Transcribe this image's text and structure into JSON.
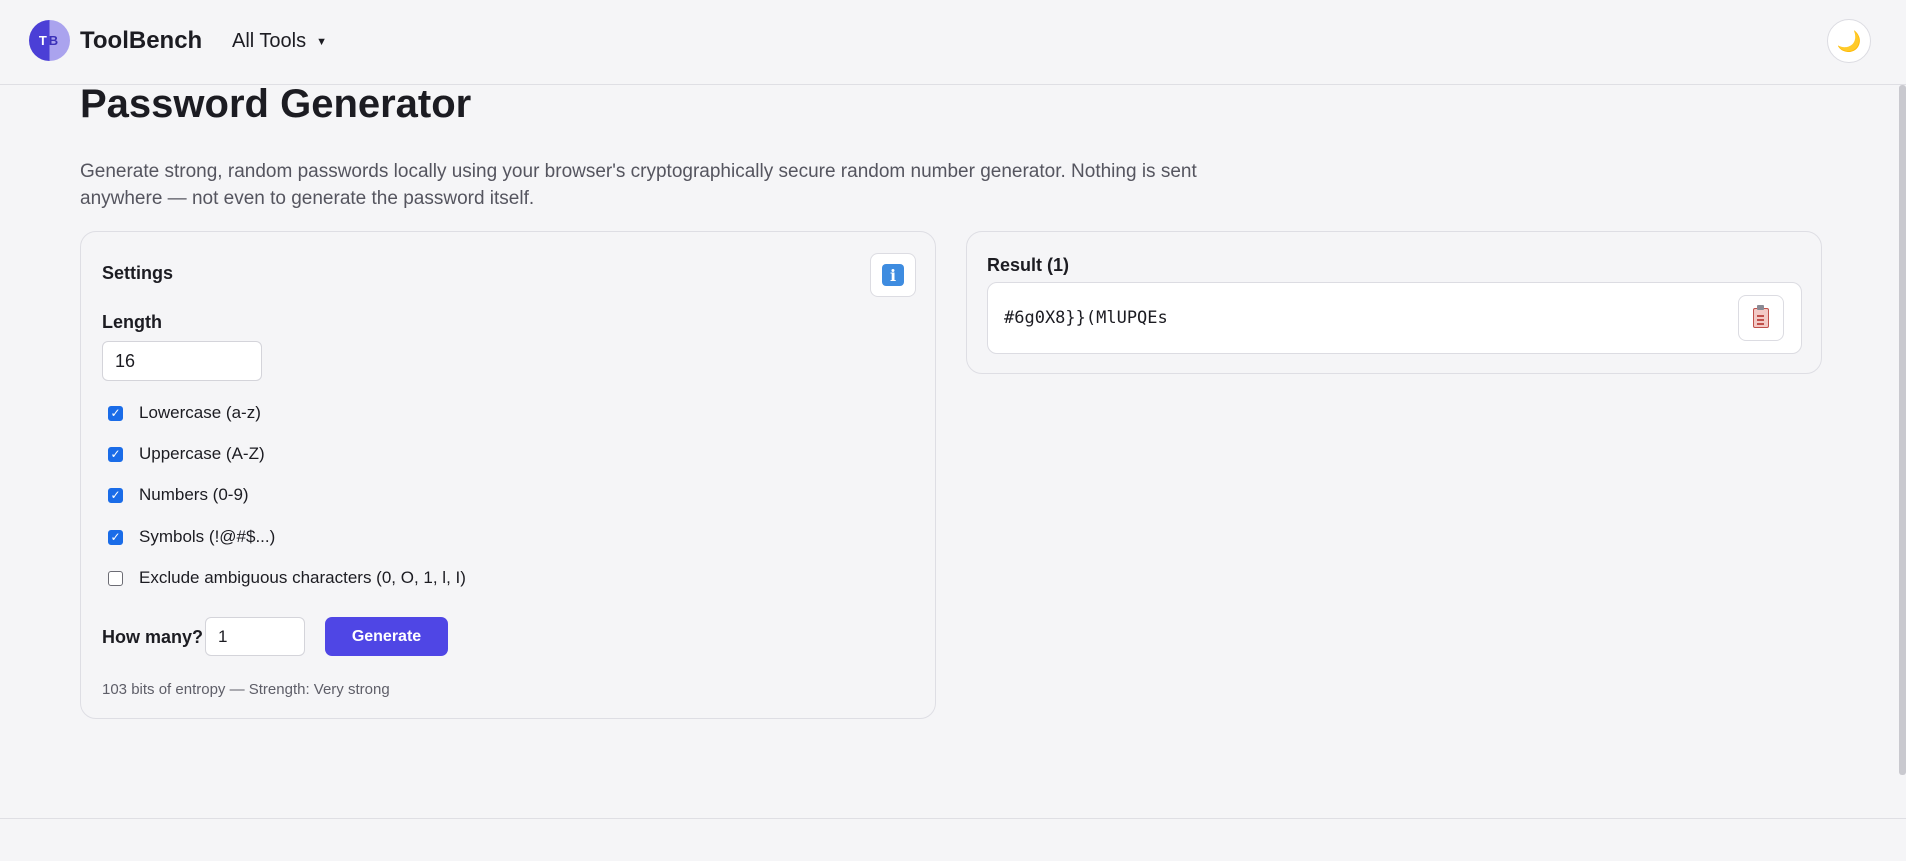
{
  "header": {
    "logo_text": [
      "T",
      "B"
    ],
    "brand": "ToolBench",
    "nav_label": "All Tools",
    "nav_caret": "▼",
    "theme_icon": "moon-icon",
    "theme_glyph": "🌙"
  },
  "page": {
    "title": "Password Generator",
    "description": "Generate strong, random passwords locally using your browser's cryptographically secure random number generator. Nothing is sent anywhere — not even to generate the password itself."
  },
  "settings": {
    "title": "Settings",
    "info_icon": "info-icon",
    "info_glyph": "i",
    "length_label": "Length",
    "length_value": "16",
    "options": [
      {
        "label": "Lowercase (a-z)",
        "checked": true
      },
      {
        "label": "Uppercase (A-Z)",
        "checked": true
      },
      {
        "label": "Numbers (0-9)",
        "checked": true
      },
      {
        "label": "Symbols (!@#$...)",
        "checked": true
      },
      {
        "label": "Exclude ambiguous characters (0, O, 1, l, I)",
        "checked": false
      }
    ],
    "how_many_label": "How many?",
    "how_many_value": "1",
    "generate_label": "Generate",
    "entropy_text": "103 bits of entropy — Strength: Very strong"
  },
  "result": {
    "title": "Result (1)",
    "password": "#6g0X8}}(MlUPQEs",
    "copy_icon": "clipboard-icon"
  },
  "colors": {
    "accent": "#4f46e5",
    "checkbox": "#1a6ce8",
    "background": "#f5f5f7"
  }
}
